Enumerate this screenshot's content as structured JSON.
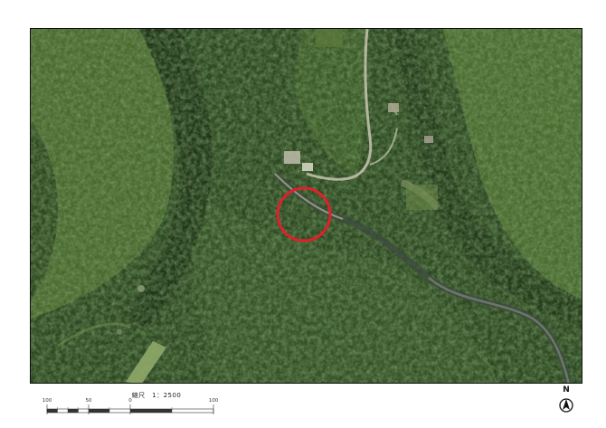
{
  "map": {
    "type": "aerial-orthophoto",
    "marker": {
      "shape": "circle",
      "color": "#e0202a"
    }
  },
  "scale": {
    "title": "縮尺　1：2500",
    "ticks": [
      "100",
      "50",
      "0",
      "100"
    ]
  },
  "north_arrow": {
    "letter": "N"
  },
  "colors": {
    "forest_dark": "#22381b",
    "forest_mid": "#3a5a2a",
    "forest_light": "#5e7e3a",
    "road": "#c9c9b8",
    "river": "#4a5a50"
  }
}
